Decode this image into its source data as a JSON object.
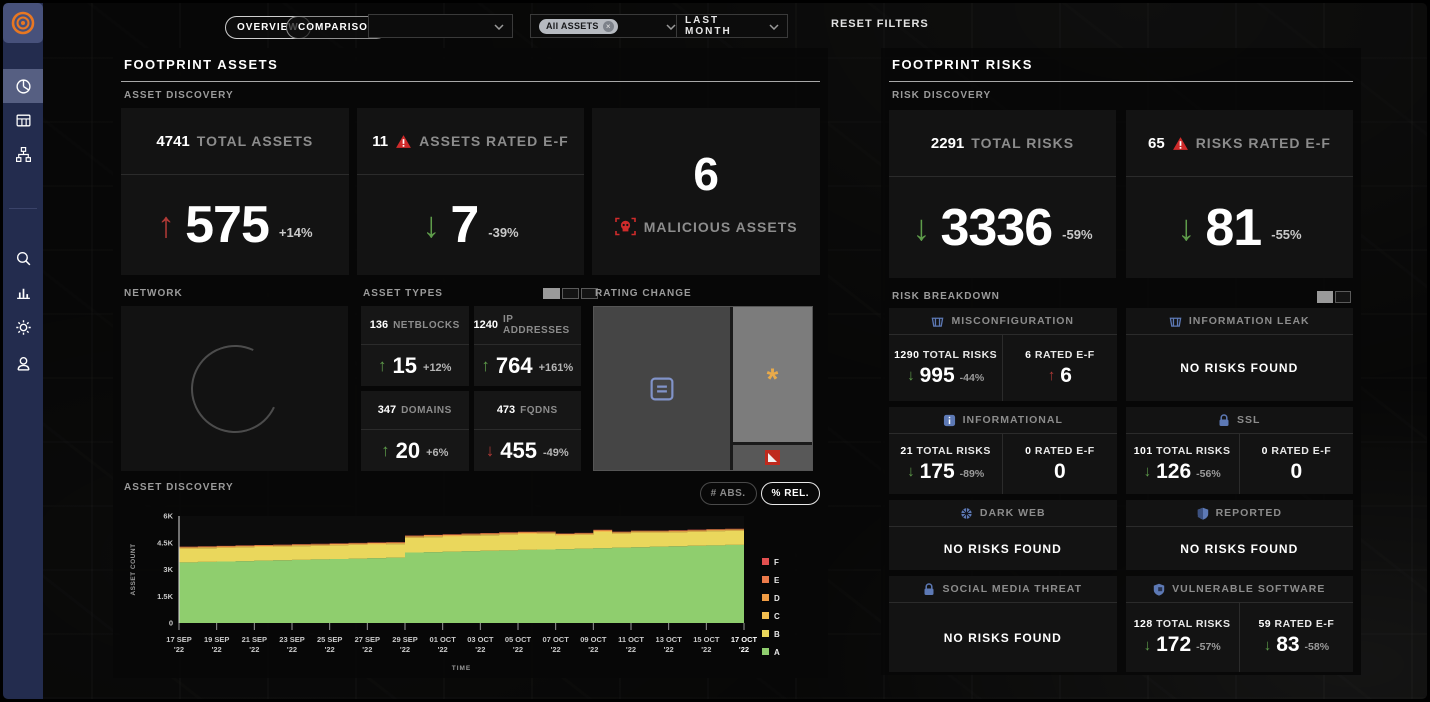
{
  "topbar": {
    "view_tabs": [
      {
        "label": "OVERVIEW"
      },
      {
        "label": "COMPARISON"
      }
    ],
    "company_select": {
      "value": ""
    },
    "asset_filter": {
      "chip_label": "All ASSETS",
      "remove_glyph": "×"
    },
    "period_select": {
      "value": "LAST MONTH"
    },
    "reset_label": "RESET FILTERS"
  },
  "sidebar": {
    "items": [
      "dashboard",
      "data-table",
      "network-map",
      "search",
      "analytics",
      "settings",
      "user"
    ],
    "active": "dashboard"
  },
  "assets_panel": {
    "title": "FOOTPRINT ASSETS",
    "discovery_label": "ASSET DISCOVERY",
    "cards": {
      "total": {
        "header_value": "4741",
        "header_label": "TOTAL ASSETS",
        "arrow_glyph": "↑",
        "value": "575",
        "pct": "+14%"
      },
      "rated": {
        "header_value": "11",
        "header_label": "ASSETS RATED E-F",
        "arrow_glyph": "↓",
        "value": "7",
        "pct": "-39%"
      },
      "malicious": {
        "value": "6",
        "label": "MALICIOUS ASSETS"
      }
    },
    "network_label": "NETWORK",
    "asset_types_label": "ASSET TYPES",
    "asset_types_toggle": {
      "options": 3,
      "selected": 0
    },
    "asset_types": [
      {
        "count": "136",
        "label": "NETBLOCKS",
        "arrow": "up",
        "value": "15",
        "pct": "+12%"
      },
      {
        "count": "1240",
        "label": "IP ADDRESSES",
        "arrow": "up",
        "value": "764",
        "pct": "+161%"
      },
      {
        "count": "347",
        "label": "DOMAINS",
        "arrow": "up",
        "value": "20",
        "pct": "+6%"
      },
      {
        "count": "473",
        "label": "FQDNS",
        "arrow": "down",
        "value": "455",
        "pct": "-49%"
      }
    ],
    "rating_change_label": "RATING CHANGE",
    "chart_label": "ASSET DISCOVERY",
    "abs_button": "# ABS.",
    "rel_button": "% REL."
  },
  "risks_panel": {
    "title": "FOOTPRINT RISKS",
    "discovery_label": "RISK DISCOVERY",
    "cards": {
      "total": {
        "header_value": "2291",
        "header_label": "TOTAL RISKS",
        "arrow_glyph": "↓",
        "value": "3336",
        "pct": "-59%"
      },
      "rated": {
        "header_value": "65",
        "header_label": "RISKS RATED E-F",
        "arrow_glyph": "↓",
        "value": "81",
        "pct": "-55%"
      }
    },
    "breakdown_label": "RISK BREAKDOWN",
    "breakdown_toggle": {
      "options": 2,
      "selected": 0
    },
    "breakdown": [
      {
        "title": "MISCONFIGURATION",
        "icon": "basket-icon",
        "stats": [
          {
            "header_value": "1290",
            "header_label": "TOTAL RISKS",
            "arrow": "down",
            "arrow_class": "green",
            "value": "995",
            "pct": "-44%"
          },
          {
            "header_value": "6",
            "header_label": "RATED E-F",
            "arrow": "up",
            "arrow_class": "red",
            "value": "6",
            "pct": ""
          }
        ]
      },
      {
        "title": "INFORMATION LEAK",
        "icon": "basket-icon",
        "empty_label": "NO RISKS FOUND"
      },
      {
        "title": "INFORMATIONAL",
        "icon": "info-icon",
        "stats": [
          {
            "header_value": "21",
            "header_label": "TOTAL RISKS",
            "arrow": "down",
            "arrow_class": "green",
            "value": "175",
            "pct": "-89%"
          },
          {
            "header_value": "0",
            "header_label": "RATED E-F",
            "arrow": "",
            "arrow_class": "",
            "value": "0",
            "pct": ""
          }
        ]
      },
      {
        "title": "SSL",
        "icon": "lock-icon",
        "stats": [
          {
            "header_value": "101",
            "header_label": "TOTAL RISKS",
            "arrow": "down",
            "arrow_class": "green",
            "value": "126",
            "pct": "-56%"
          },
          {
            "header_value": "0",
            "header_label": "RATED E-F",
            "arrow": "",
            "arrow_class": "",
            "value": "0",
            "pct": ""
          }
        ]
      },
      {
        "title": "DARK WEB",
        "icon": "globe-icon",
        "empty_label": "NO RISKS FOUND"
      },
      {
        "title": "REPORTED",
        "icon": "shield-icon",
        "empty_label": "NO RISKS FOUND"
      },
      {
        "title": "SOCIAL MEDIA THREAT",
        "icon": "lock-icon",
        "empty_label": "NO RISKS FOUND"
      },
      {
        "title": "VULNERABLE SOFTWARE",
        "icon": "shield-check-icon",
        "stats": [
          {
            "header_value": "128",
            "header_label": "TOTAL RISKS",
            "arrow": "down",
            "arrow_class": "green",
            "value": "172",
            "pct": "-57%"
          },
          {
            "header_value": "59",
            "header_label": "RATED E-F",
            "arrow": "down",
            "arrow_class": "green",
            "value": "83",
            "pct": "-58%"
          }
        ]
      }
    ]
  },
  "colors": {
    "accent_orange": "#e87722",
    "trend_red": "#b03a36",
    "trend_green": "#5e9c4a",
    "icon_blue": "#5d79b5",
    "warning_red": "#cf2b2b",
    "sidebar_navy": "#232c4e"
  },
  "chart_data": {
    "type": "area",
    "stacked": true,
    "title": "ASSET DISCOVERY",
    "xlabel": "TIME",
    "ylabel": "ASSET COUNT",
    "ylim": [
      0,
      6000
    ],
    "yticks": [
      "0",
      "1.5K",
      "3K",
      "4.5K",
      "6K"
    ],
    "x_tick_labels": [
      "17 SEP",
      "19 SEP",
      "21 SEP",
      "23 SEP",
      "25 SEP",
      "27 SEP",
      "29 SEP",
      "01 OCT",
      "03 OCT",
      "05 OCT",
      "07 OCT",
      "09 OCT",
      "11 OCT",
      "13 OCT",
      "15 OCT",
      "17 OCT"
    ],
    "x_tick_year": "'22",
    "grid": false,
    "legend_position": "right",
    "legend_order": [
      "F",
      "E",
      "D",
      "C",
      "B",
      "A"
    ],
    "series": [
      {
        "name": "A",
        "color": "#8fce6e",
        "values": [
          3400,
          3425,
          3450,
          3470,
          3495,
          3520,
          3540,
          3565,
          3590,
          3610,
          3640,
          3665,
          3950,
          3975,
          4000,
          4030,
          4050,
          4075,
          4100,
          4120,
          4145,
          4170,
          4200,
          4230,
          4250,
          4280,
          4305,
          4330,
          4350,
          4380,
          4550
        ]
      },
      {
        "name": "B",
        "color": "#ead75c",
        "values": [
          770,
          765,
          760,
          770,
          765,
          760,
          770,
          765,
          760,
          770,
          765,
          760,
          830,
          840,
          850,
          860,
          870,
          880,
          890,
          880,
          760,
          770,
          900,
          780,
          820,
          790,
          780,
          790,
          800,
          790,
          780
        ]
      },
      {
        "name": "C",
        "color": "#f2bd4f",
        "values": [
          55,
          55,
          55,
          55,
          55,
          55,
          55,
          55,
          55,
          55,
          55,
          55,
          60,
          60,
          60,
          60,
          60,
          60,
          60,
          60,
          55,
          55,
          60,
          55,
          55,
          55,
          55,
          55,
          55,
          55,
          65
        ]
      },
      {
        "name": "D",
        "color": "#f09c44",
        "values": [
          30,
          30,
          30,
          30,
          30,
          30,
          30,
          30,
          30,
          30,
          30,
          30,
          35,
          35,
          35,
          35,
          35,
          35,
          35,
          35,
          30,
          30,
          35,
          30,
          30,
          30,
          30,
          30,
          30,
          30,
          45
        ]
      },
      {
        "name": "E",
        "color": "#ec7a4a",
        "values": [
          20,
          20,
          20,
          20,
          20,
          20,
          20,
          20,
          20,
          20,
          20,
          20,
          25,
          25,
          25,
          25,
          25,
          25,
          25,
          25,
          20,
          20,
          25,
          20,
          20,
          20,
          20,
          20,
          20,
          20,
          35
        ]
      },
      {
        "name": "F",
        "color": "#e35050",
        "values": [
          8,
          8,
          8,
          8,
          8,
          8,
          8,
          8,
          8,
          8,
          8,
          8,
          10,
          10,
          10,
          10,
          10,
          10,
          10,
          10,
          8,
          8,
          10,
          8,
          8,
          8,
          8,
          8,
          8,
          8,
          15
        ]
      }
    ]
  }
}
